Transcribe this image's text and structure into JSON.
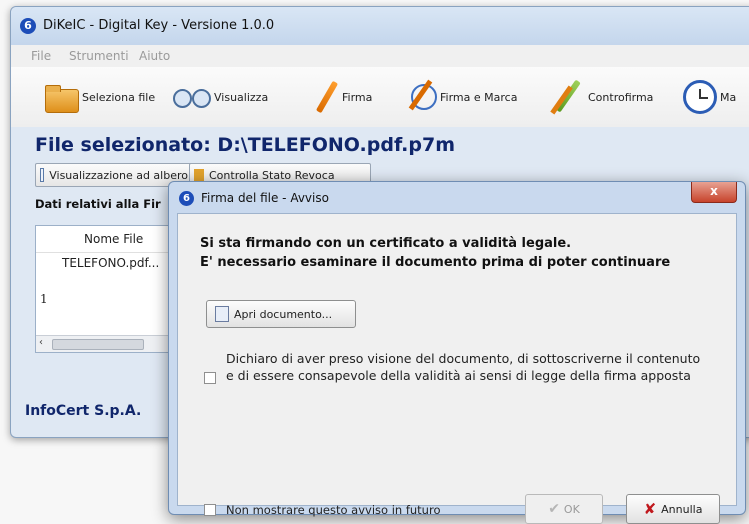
{
  "window": {
    "title": "DiKeIC - Digital Key - Versione 1.0.0",
    "icon": "app-logo-icon"
  },
  "menu": {
    "items": [
      "File",
      "Strumenti",
      "Aiuto"
    ]
  },
  "toolbar": {
    "buttons": [
      {
        "label": "Seleziona file",
        "icon": "folder-icon"
      },
      {
        "label": "Visualizza",
        "icon": "glasses-icon"
      },
      {
        "label": "Firma",
        "icon": "pen-icon"
      },
      {
        "label": "Firma e Marca",
        "icon": "pen-clock-icon"
      },
      {
        "label": "Controfirma",
        "icon": "double-pen-icon"
      },
      {
        "label": "Ma",
        "icon": "clock-icon"
      }
    ]
  },
  "file_selected": "File selezionato: D:\\TELEFONO.pdf.p7m",
  "sub_buttons": [
    "Visualizzazione ad albero",
    "Controlla Stato Revoca"
  ],
  "data_label": "Dati relativi alla Fir",
  "grid": {
    "column_header": "Nome File",
    "cell": "TELEFONO.pdf...",
    "row_number": "1",
    "scroll_left": "‹"
  },
  "company": "InfoCert S.p.A.",
  "dialog": {
    "title": "Firma del file - Avviso",
    "close": "x",
    "warning_line1": "Si sta firmando con un certificato a validità legale.",
    "warning_line2": "E' necessario esaminare il documento prima di poter continuare",
    "open_button": "Apri documento...",
    "declaration": "Dichiaro di aver preso visione del documento, di sottoscriverne il contenuto e di essere consapevole della validità ai sensi di legge della firma apposta",
    "no_more": "Non mostrare questo avviso in futuro",
    "ok": "OK",
    "cancel": "Annulla"
  },
  "colors": {
    "title_blue": "#10266b",
    "dialog_frame": "#c9d9ee",
    "cancel_x": "#c0181d"
  }
}
